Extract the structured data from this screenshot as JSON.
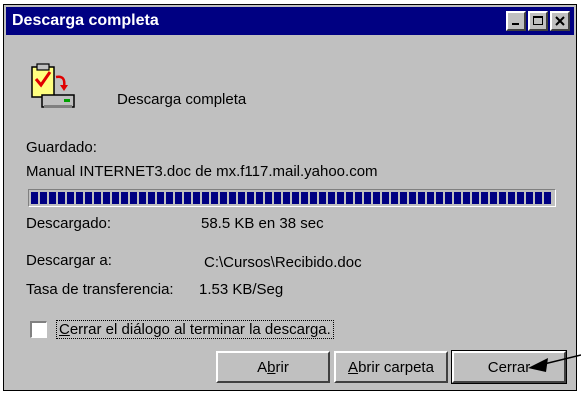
{
  "window": {
    "title": "Descarga completa",
    "controls": {
      "minimize_icon": "minimize-icon",
      "maximize_icon": "maximize-icon",
      "close_icon": "close-icon"
    }
  },
  "header": {
    "icon": "clipboard-download-icon",
    "text": "Descarga completa"
  },
  "saved": {
    "label": "Guardado:",
    "value": "Manual INTERNET3.doc de mx.f117.mail.yahoo.com"
  },
  "progress": {
    "percent": 100
  },
  "details": {
    "downloaded_label": "Descargado:",
    "downloaded_value": "58.5 KB en  38 sec",
    "download_to_label": "Descargar a:",
    "download_to_value": "C:\\Cursos\\Recibido.doc",
    "rate_label": "Tasa de transferencia:",
    "rate_value": "1.53 KB/Seg"
  },
  "checkbox": {
    "label_accel": "C",
    "label_rest": "errar el diálogo al terminar la descarga.",
    "checked": false
  },
  "buttons": {
    "open_pre": "A",
    "open_accel": "b",
    "open_post": "rir",
    "open_folder_accel": "A",
    "open_folder_post": "brir carpeta",
    "close_label": "Cerrar"
  },
  "colors": {
    "titlebar": "#000082",
    "face": "#c0c0c0",
    "progress": "#000082"
  }
}
